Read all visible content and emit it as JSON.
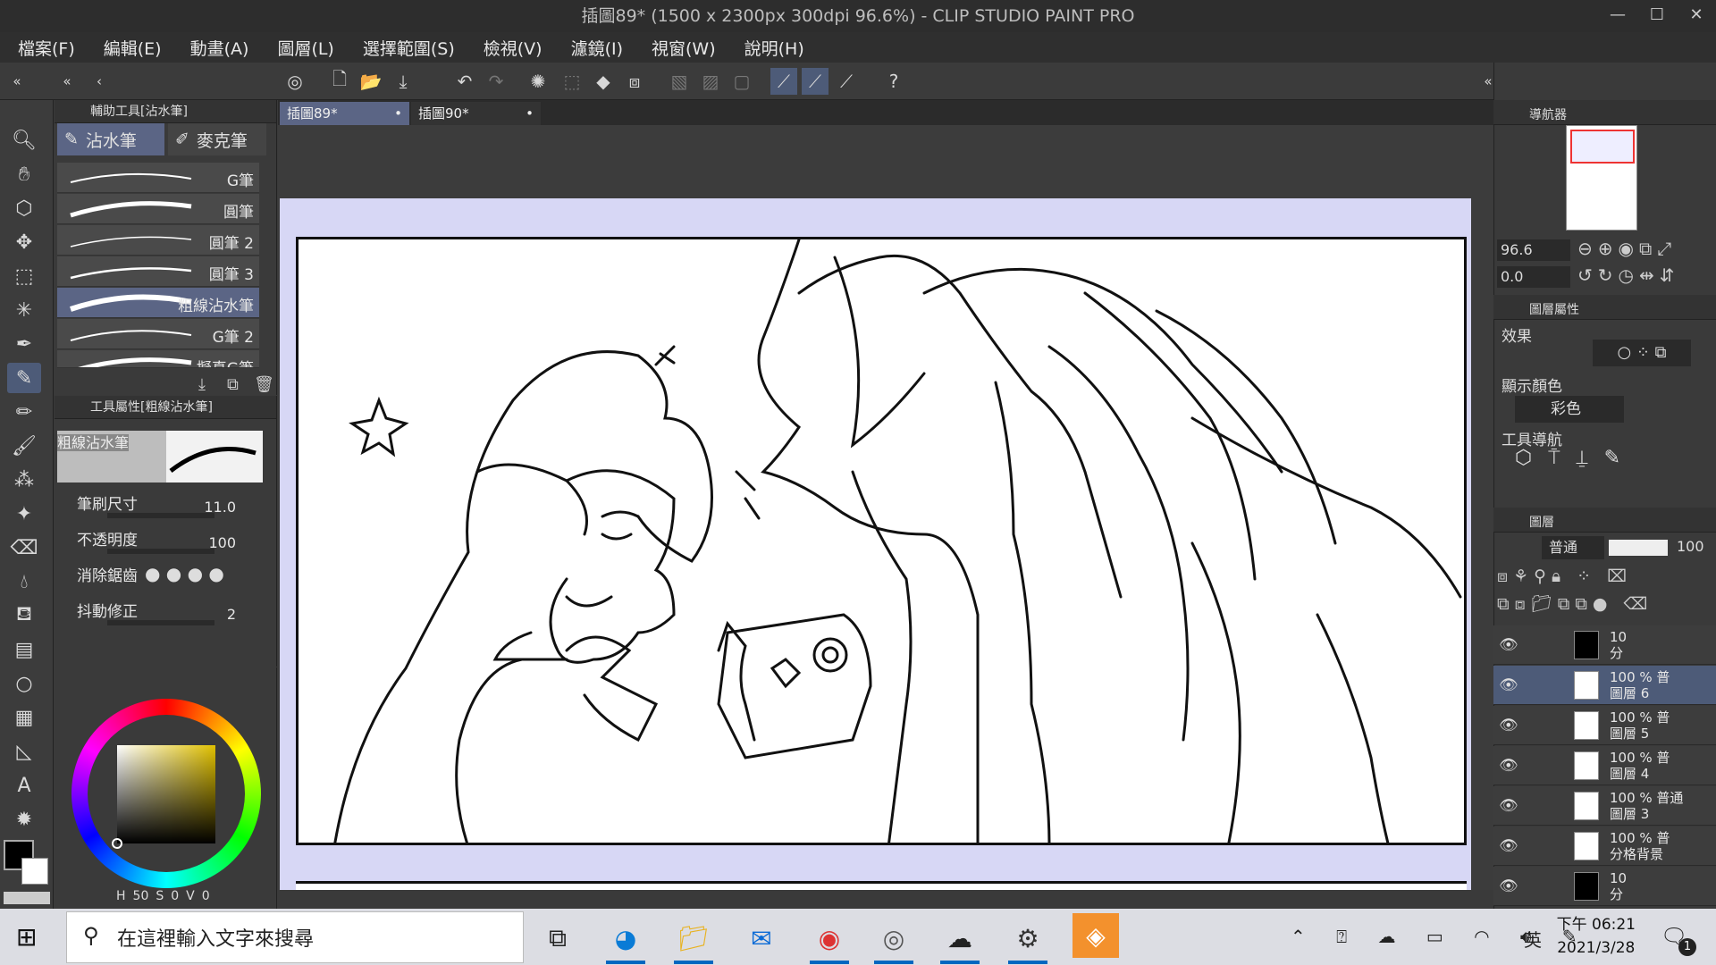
{
  "window": {
    "title": "插圖89* (1500 x 2300px 300dpi 96.6%)  - CLIP STUDIO PAINT PRO",
    "controls": [
      "—",
      "☐",
      "✕"
    ]
  },
  "menu": [
    "檔案(F)",
    "編輯(E)",
    "動畫(A)",
    "圖層(L)",
    "選擇範圍(S)",
    "檢視(V)",
    "濾鏡(I)",
    "視窗(W)",
    "說明(H)"
  ],
  "subtool_panel": {
    "header": "輔助工具[沾水筆]",
    "tabs": [
      "沾水筆",
      "麥克筆"
    ],
    "brushes": [
      "G筆",
      "圓筆",
      "圓筆 2",
      "圓筆 3",
      "粗線沾水筆",
      "G筆 2",
      "擬真G筆"
    ]
  },
  "tool_property": {
    "header": "工具屬性[粗線沾水筆]",
    "brush_name": "粗線沾水筆",
    "size_label": "筆刷尺寸",
    "size_value": "11.0",
    "opacity_label": "不透明度",
    "opacity_value": "100",
    "antialias_label": "消除鋸齒",
    "stabilizer_label": "抖動修正",
    "stabilizer_value": "2"
  },
  "color": {
    "h_label": "H",
    "h_value": "50",
    "s_label": "S",
    "s_value": "0",
    "v_label": "V",
    "v_value": "0",
    "main_color": "#000000",
    "sub_color": "#ffffff"
  },
  "canvas_tabs": [
    "插圖89*",
    "插圖90*"
  ],
  "navigator": {
    "header": "導航器",
    "zoom": "96.6",
    "rotate": "0.0"
  },
  "layer_property": {
    "header": "圖層屬性",
    "effect_label": "效果",
    "display_color_label": "顯示顏色",
    "display_color_value": "彩色",
    "tool_nav_label": "工具導航"
  },
  "layers_panel": {
    "header": "圖層",
    "blend_mode": "普通",
    "opacity": "100",
    "layers": [
      {
        "pct": "10",
        "name": "分"
      },
      {
        "pct": "100 % 普",
        "name": "圖層 6"
      },
      {
        "pct": "100 % 普",
        "name": "圖層 5"
      },
      {
        "pct": "100 % 普",
        "name": "圖層 4"
      },
      {
        "pct": "100 % 普通",
        "name": "圖層 3"
      },
      {
        "pct": "100 % 普",
        "name": "分格背景"
      },
      {
        "pct": "10",
        "name": "分"
      }
    ]
  },
  "taskbar": {
    "search_placeholder": "在這裡輸入文字來搜尋",
    "ime": "英",
    "time": "下午 06:21",
    "date": "2021/3/28",
    "notifications": "1"
  }
}
